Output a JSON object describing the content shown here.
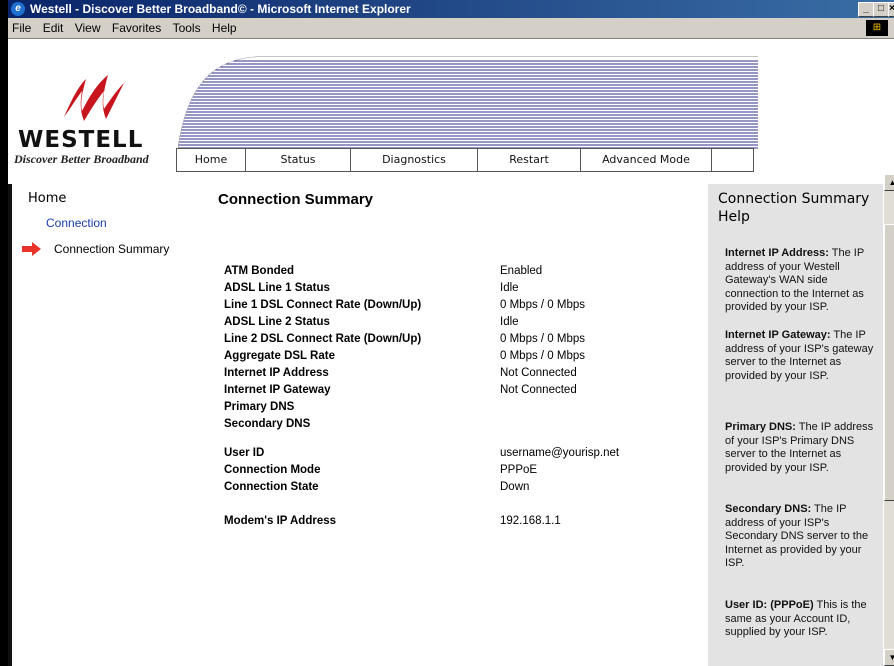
{
  "window": {
    "title": "Westell - Discover Better Broadband© - Microsoft Internet Explorer",
    "menu": [
      "File",
      "Edit",
      "View",
      "Favorites",
      "Tools",
      "Help"
    ]
  },
  "header": {
    "brand": "WESTELL",
    "tagline": "Discover Better Broadband",
    "nav": [
      "Home",
      "Status",
      "Diagnostics",
      "Restart",
      "Advanced Mode"
    ]
  },
  "sidebar": {
    "home": "Home",
    "items": [
      "Connection",
      "Connection Summary"
    ]
  },
  "main": {
    "title": "Connection Summary",
    "rows": [
      {
        "label": "ATM Bonded",
        "value": "Enabled"
      },
      {
        "label": "ADSL Line 1 Status",
        "value": "Idle"
      },
      {
        "label": "Line 1 DSL Connect Rate (Down/Up)",
        "value": "0 Mbps / 0 Mbps"
      },
      {
        "label": "ADSL Line 2 Status",
        "value": "Idle"
      },
      {
        "label": "Line 2 DSL Connect Rate (Down/Up)",
        "value": "0 Mbps / 0 Mbps"
      },
      {
        "label": "Aggregate DSL Rate",
        "value": "0 Mbps / 0 Mbps"
      },
      {
        "label": "Internet IP Address",
        "value": "Not Connected"
      },
      {
        "label": "Internet IP Gateway",
        "value": "Not Connected"
      },
      {
        "label": "Primary DNS",
        "value": ""
      },
      {
        "label": "Secondary DNS",
        "value": ""
      },
      {
        "label": "User ID",
        "value": "username@yourisp.net"
      },
      {
        "label": "Connection Mode",
        "value": "PPPoE"
      },
      {
        "label": "Connection State",
        "value": "Down"
      },
      {
        "label": "Modem's IP Address",
        "value": "192.168.1.1"
      }
    ]
  },
  "help": {
    "title": "Connection Summary Help",
    "items": [
      {
        "term": "Internet IP Address:",
        "text": " The IP address of your Westell Gateway's WAN side connection to the Internet as provided by your ISP."
      },
      {
        "term": "Internet IP Gateway:",
        "text": " The IP address of your ISP's gateway server to the Internet as provided by your ISP."
      },
      {
        "term": "Primary DNS:",
        "text": " The IP address of your ISP's Primary DNS server to the Internet as provided by your ISP."
      },
      {
        "term": "Secondary DNS:",
        "text": " The IP address of your ISP's Secondary DNS server to the Internet as provided by your ISP."
      },
      {
        "term": "User ID: (PPPoE)",
        "text": " This is the same as your Account ID, supplied by your ISP."
      }
    ]
  },
  "colors": {
    "titlebar": "#0a246a",
    "link": "#1a3ca8",
    "arrow": "#e8322a",
    "help_bg": "#e3e3e3"
  }
}
